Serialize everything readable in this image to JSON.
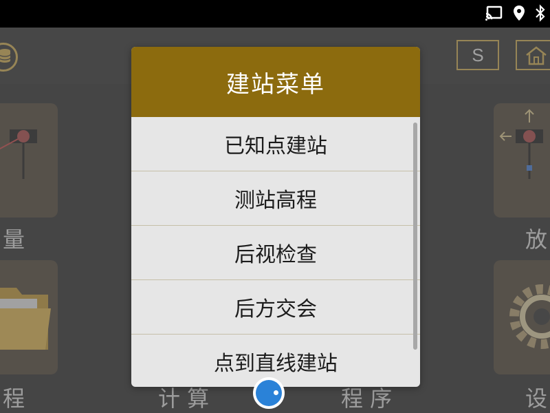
{
  "status_bar": {
    "icons": [
      "cast-icon",
      "location-icon",
      "bluetooth-icon"
    ]
  },
  "header": {
    "s_button_label": "S"
  },
  "tiles": {
    "measure_label": "量",
    "stakeout_label": "放",
    "program_left_label": "程",
    "calculate_label": "计 算",
    "program_label": "程 序",
    "settings_label": "设"
  },
  "dialog": {
    "title": "建站菜单",
    "items": [
      {
        "label": "已知点建站"
      },
      {
        "label": "测站高程"
      },
      {
        "label": "后视检查"
      },
      {
        "label": "后方交会"
      },
      {
        "label": "点到直线建站"
      }
    ]
  },
  "colors": {
    "accent_gold": "#8c6b0e",
    "dialog_background": "#e6e6e6",
    "camera_blue": "#2a82d8"
  }
}
